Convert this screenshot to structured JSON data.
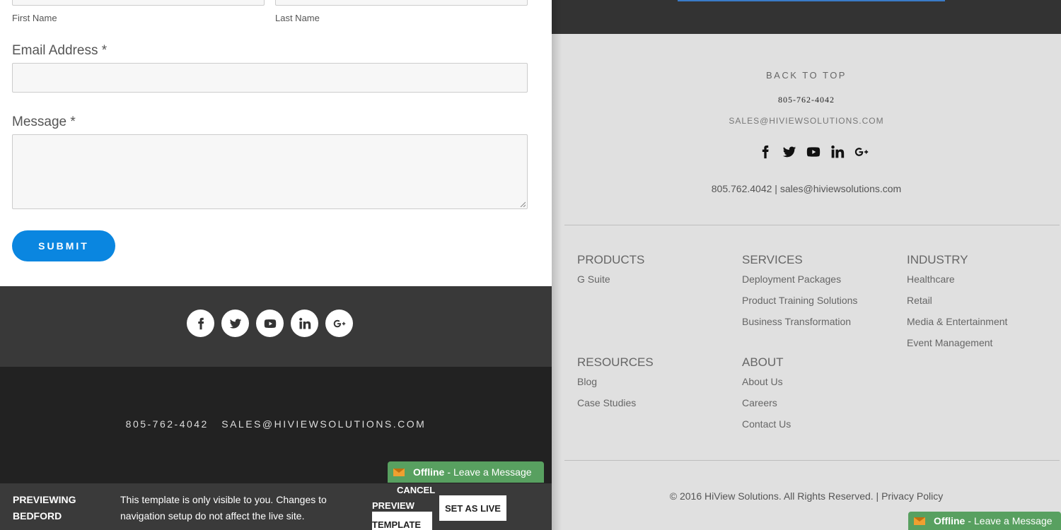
{
  "form": {
    "first_name_label": "First Name",
    "last_name_label": "Last Name",
    "email_label": "Email Address *",
    "message_label": "Message *",
    "submit_label": "SUBMIT"
  },
  "left_footer": {
    "social_icons": [
      "facebook-icon",
      "twitter-icon",
      "youtube-icon",
      "linkedin-icon",
      "google-plus-icon"
    ],
    "phone": "805-762-4042",
    "email": "SALES@HIVIEWSOLUTIONS.COM"
  },
  "chat": {
    "status": "Offline",
    "separator": "-",
    "action": "Leave a Message"
  },
  "preview_bar": {
    "title_line1": "PREVIEWING",
    "title_line2": "BEDFORD",
    "desc_line1": "This template is only visible to you. Changes to",
    "desc_line2": "navigation setup do not affect the live site.",
    "cancel_label": "CANCEL",
    "preview_label": "PREVIEW",
    "template_label": "TEMPLATE",
    "set_live_label": "SET AS LIVE"
  },
  "right_footer": {
    "back_to_top": "BACK TO TOP",
    "phone": "805-762-4042",
    "email": "SALES@HIVIEWSOLUTIONS.COM",
    "contact_line": "805.762.4042 | sales@hiviewsolutions.com",
    "columns": {
      "products": {
        "heading": "PRODUCTS",
        "links": [
          "G Suite"
        ]
      },
      "services": {
        "heading": "SERVICES",
        "links": [
          "Deployment Packages",
          "Product Training Solutions",
          "Business Transformation"
        ]
      },
      "industry": {
        "heading": "INDUSTRY",
        "links": [
          "Healthcare",
          "Retail",
          "Media & Entertainment",
          "Event Management"
        ]
      },
      "resources": {
        "heading": "RESOURCES",
        "links": [
          "Blog",
          "Case Studies"
        ]
      },
      "about": {
        "heading": "ABOUT",
        "links": [
          "About Us",
          "Careers",
          "Contact Us"
        ]
      }
    },
    "copyright": "© 2016 HiView Solutions. All Rights Reserved. | Privacy Policy"
  },
  "colors": {
    "submit": "#0a86e0",
    "chat_green": "#58a060",
    "dark_band": "#393939",
    "darker_band": "#222222",
    "right_bg": "#e0e0e0"
  }
}
